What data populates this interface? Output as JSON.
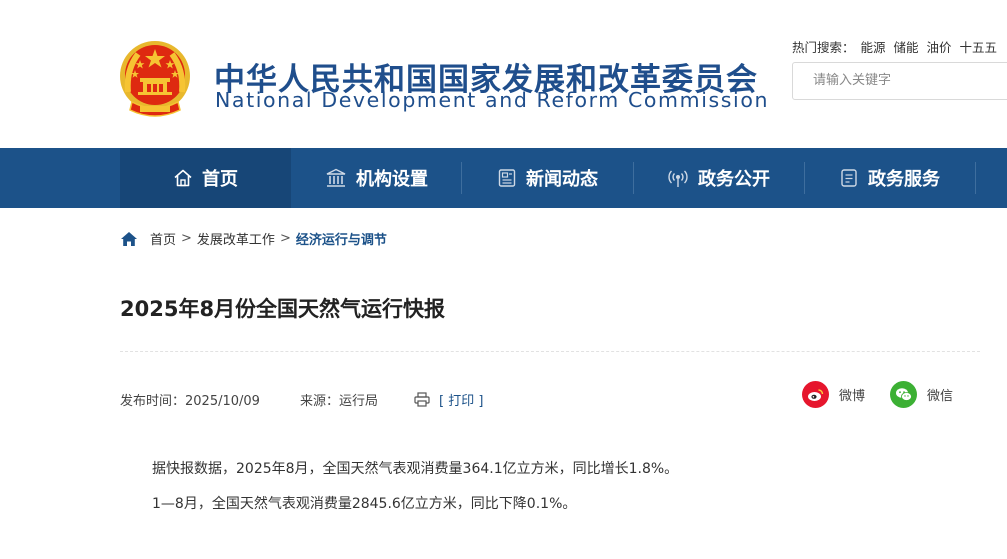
{
  "header": {
    "title_cn": "中华人民共和国国家发展和改革委员会",
    "title_en": "National Development and Reform Commission",
    "hot_search_label": "热门搜索：",
    "hot_terms": [
      "能源",
      "储能",
      "油价",
      "十五五"
    ],
    "search_placeholder": "请输入关键字"
  },
  "nav": {
    "items": [
      {
        "label": "首页",
        "icon": "home-icon",
        "active": true
      },
      {
        "label": "机构设置",
        "icon": "institution-icon"
      },
      {
        "label": "新闻动态",
        "icon": "news-icon"
      },
      {
        "label": "政务公开",
        "icon": "broadcast-icon"
      },
      {
        "label": "政务服务",
        "icon": "service-icon"
      }
    ]
  },
  "breadcrumb": {
    "items": [
      "首页",
      "发展改革工作",
      "经济运行与调节"
    ],
    "separator": ">"
  },
  "article": {
    "title": "2025年8月份全国天然气运行快报",
    "publish_label": "发布时间：2025/10/09",
    "source_label": "来源：运行局",
    "print_label": "[ 打印 ]",
    "paragraphs": [
      "据快报数据，2025年8月，全国天然气表观消费量364.1亿立方米，同比增长1.8%。",
      "1—8月，全国天然气表观消费量2845.6亿立方米，同比下降0.1%。"
    ]
  },
  "share": {
    "weibo_label": "微博",
    "wechat_label": "微信"
  },
  "colors": {
    "brand_blue": "#1c5289",
    "nav_active": "#174677",
    "weibo_red": "#e6162d",
    "wechat_green": "#3cb034",
    "emblem_red": "#de2910",
    "emblem_gold": "#f6c433"
  }
}
